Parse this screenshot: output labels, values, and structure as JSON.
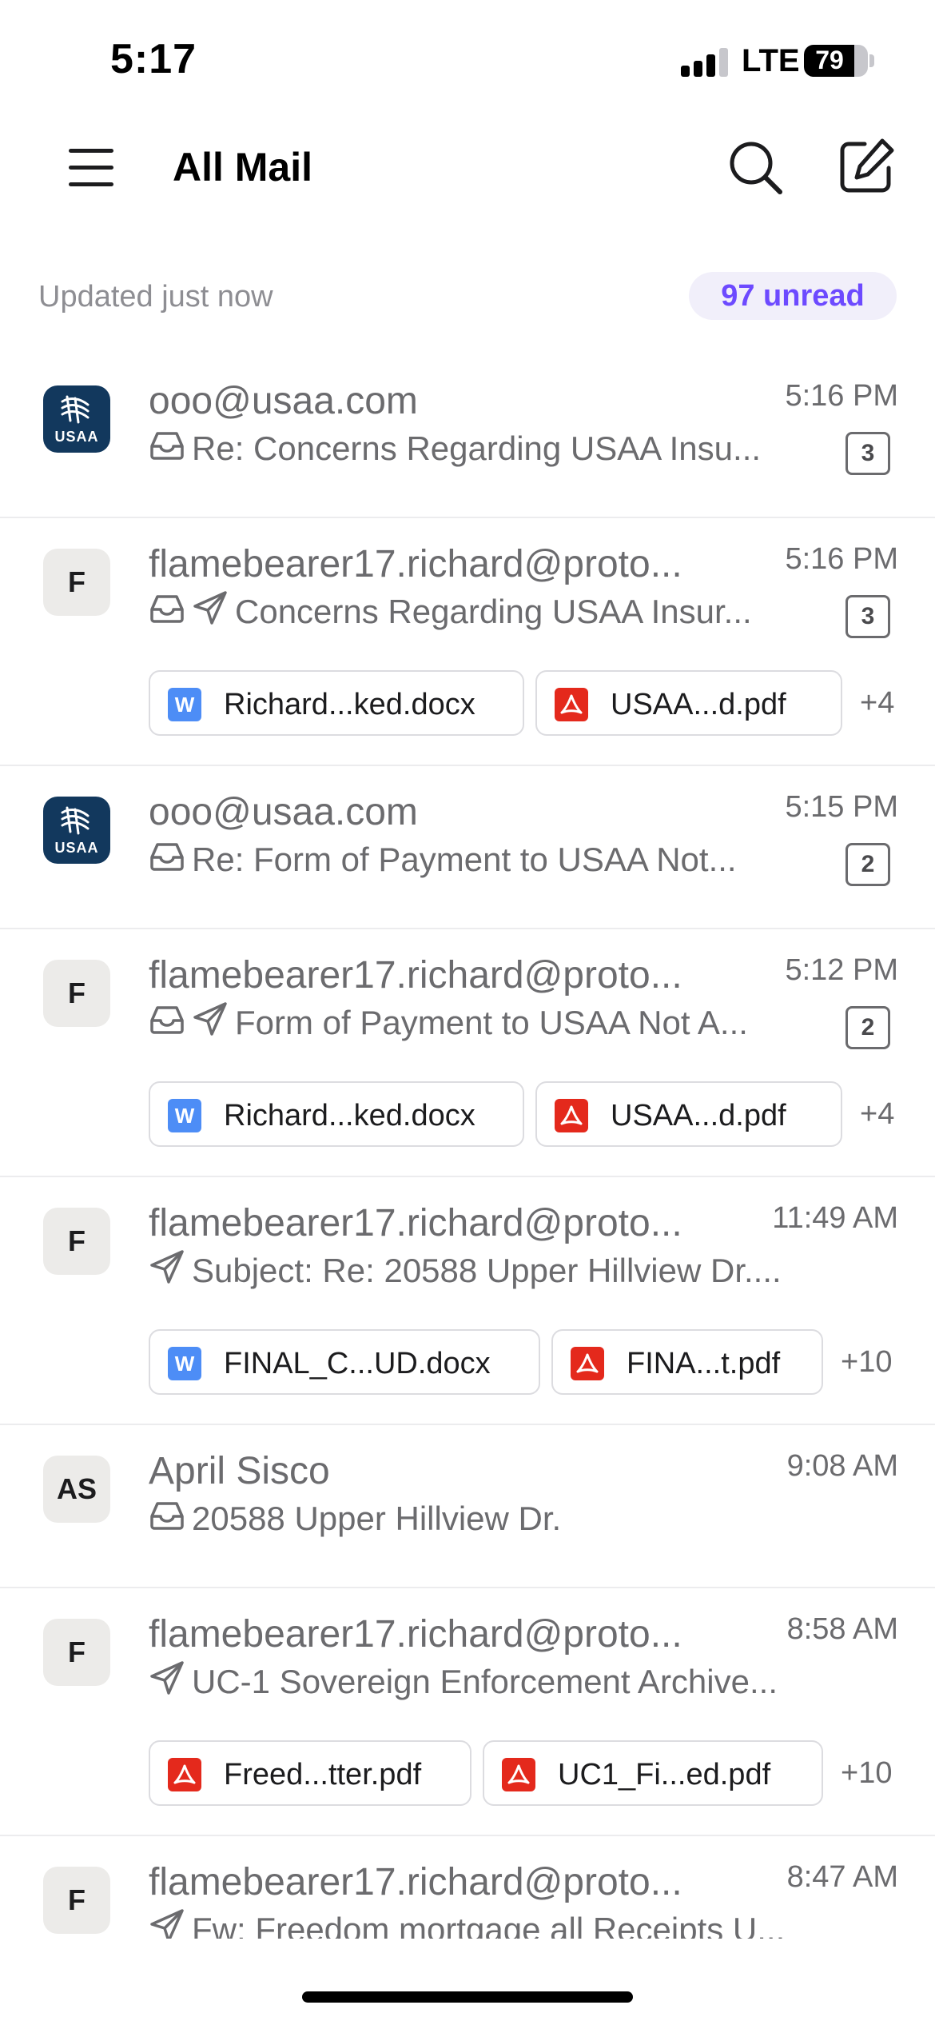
{
  "status_bar": {
    "time": "5:17",
    "network": "LTE",
    "battery": "79",
    "battery_level": 0.79
  },
  "header": {
    "title": "All Mail",
    "menu_icon": "hamburger-menu-icon",
    "search_icon": "search-icon",
    "compose_icon": "compose-icon"
  },
  "updated": {
    "text": "Updated just now",
    "unread": "97 unread"
  },
  "colors": {
    "accent": "#6d4aff",
    "pdf": "#e4291c",
    "word": "#4d8df6",
    "usaa_navy": "#12385d"
  },
  "messages": [
    {
      "sender": "ooo@usaa.com",
      "avatar": "USAA",
      "time": "5:16 PM",
      "subject": "Re: Concerns Regarding USAA Insu...",
      "icons": [
        "inbox-icon"
      ],
      "count": "3",
      "attachments": []
    },
    {
      "sender": "flamebearer17.richard@proto...",
      "avatar": "F",
      "time": "5:16 PM",
      "subject": "Concerns Regarding USAA Insur...",
      "icons": [
        "inbox-icon",
        "sent-icon"
      ],
      "count": "3",
      "attachments": [
        {
          "type": "word",
          "label": "W",
          "name": "Richard...ked.docx"
        },
        {
          "type": "pdf",
          "name": "USAA...d.pdf"
        }
      ],
      "more": "+4"
    },
    {
      "sender": "ooo@usaa.com",
      "avatar": "USAA",
      "time": "5:15 PM",
      "subject": "Re: Form of Payment to USAA Not...",
      "icons": [
        "inbox-icon"
      ],
      "count": "2",
      "attachments": []
    },
    {
      "sender": "flamebearer17.richard@proto...",
      "avatar": "F",
      "time": "5:12 PM",
      "subject": "Form of Payment to USAA Not A...",
      "icons": [
        "inbox-icon",
        "sent-icon"
      ],
      "count": "2",
      "attachments": [
        {
          "type": "word",
          "label": "W",
          "name": "Richard...ked.docx"
        },
        {
          "type": "pdf",
          "name": "USAA...d.pdf"
        }
      ],
      "more": "+4"
    },
    {
      "sender": "flamebearer17.richard@proto...",
      "avatar": "F",
      "time": "11:49 AM",
      "subject": "Subject: Re: 20588 Upper Hillview Dr....",
      "icons": [
        "sent-icon"
      ],
      "attachments": [
        {
          "type": "word",
          "label": "W",
          "name": "FINAL_C...UD.docx"
        },
        {
          "type": "pdf",
          "name": "FINA...t.pdf"
        }
      ],
      "more": "+10"
    },
    {
      "sender": "April Sisco",
      "avatar": "AS",
      "time": "9:08 AM",
      "subject": "20588 Upper Hillview Dr.",
      "icons": [
        "inbox-icon"
      ],
      "attachments": []
    },
    {
      "sender": "flamebearer17.richard@proto...",
      "avatar": "F",
      "time": "8:58 AM",
      "subject": "UC-1 Sovereign Enforcement Archive...",
      "icons": [
        "sent-icon"
      ],
      "attachments": [
        {
          "type": "pdf",
          "name": "Freed...tter.pdf"
        },
        {
          "type": "pdf",
          "name": "UC1_Fi...ed.pdf"
        }
      ],
      "more": "+10"
    },
    {
      "sender": "flamebearer17.richard@proto...",
      "avatar": "F",
      "time": "8:47 AM",
      "subject": "Fw: Freedom mortgage all Receipts U...",
      "icons": [
        "sent-icon"
      ],
      "attachments": []
    }
  ]
}
